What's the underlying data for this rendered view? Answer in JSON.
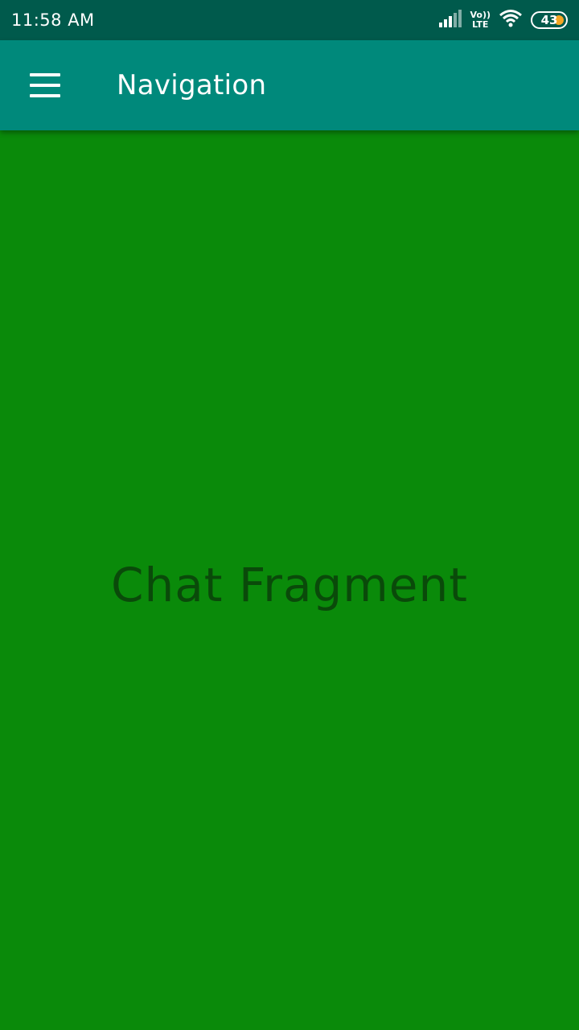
{
  "status_bar": {
    "time": "11:58 AM",
    "volte_top": "Vo))",
    "volte_bottom": "LTE",
    "battery_level": "43",
    "icons": [
      "signal-icon",
      "volte-icon",
      "wifi-icon",
      "battery-icon"
    ],
    "battery_color": "#f5a623"
  },
  "app_bar": {
    "title": "Navigation",
    "menu_icon": "hamburger-menu-icon",
    "background": "#00897b"
  },
  "content": {
    "label": "Chat Fragment",
    "background": "#0a8a0a"
  }
}
